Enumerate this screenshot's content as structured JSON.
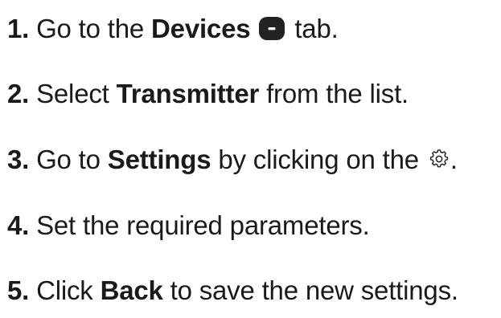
{
  "steps": [
    {
      "number": "1.",
      "before": "Go to the ",
      "strong": "Devices",
      "icon": "device-icon",
      "after": " tab."
    },
    {
      "number": "2.",
      "before": "Select ",
      "strong": "Transmitter",
      "after": " from the list."
    },
    {
      "number": "3.",
      "before": "Go to ",
      "strong": "Settings",
      "middle": " by clicking on the ",
      "icon": "gear-icon",
      "after": "."
    },
    {
      "number": "4.",
      "text": "Set the required parameters."
    },
    {
      "number": "5.",
      "before": "Click ",
      "strong": "Back",
      "after": " to save the new settings."
    }
  ],
  "colors": {
    "text": "#1a1a1a",
    "icon_fill": "#222222",
    "icon_mark": "#ffffff"
  }
}
